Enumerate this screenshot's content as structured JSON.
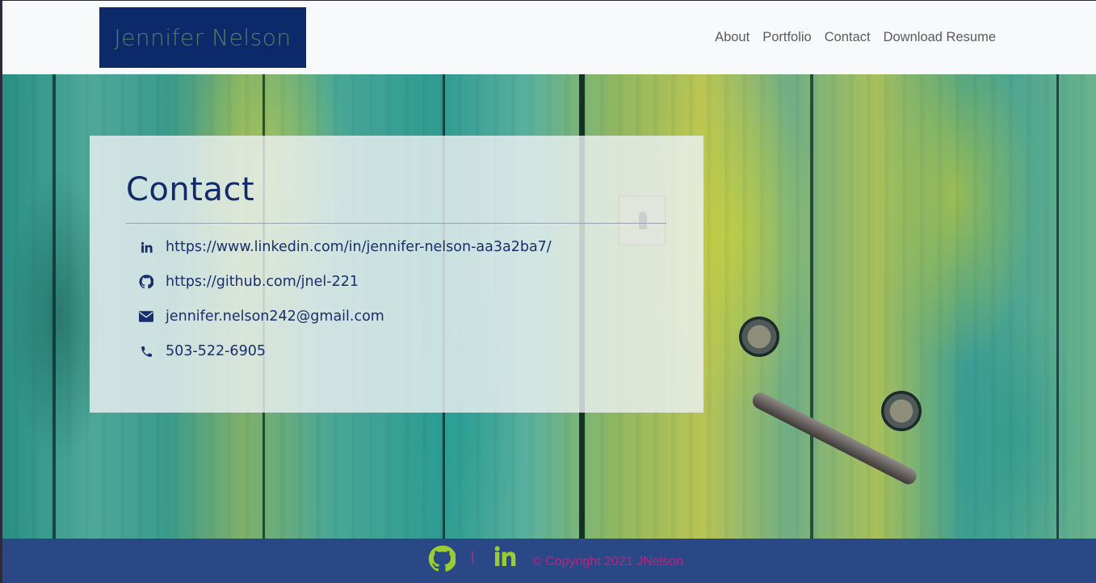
{
  "brand": {
    "name": "Jennifer Nelson",
    "bg_color": "#0c2a6a"
  },
  "nav": {
    "items": [
      {
        "label": "About"
      },
      {
        "label": "Portfolio"
      },
      {
        "label": "Contact"
      },
      {
        "label": "Download Resume"
      }
    ]
  },
  "contact": {
    "title": "Contact",
    "rows": [
      {
        "icon": "linkedin-icon",
        "text": "https://www.linkedin.com/in/jennifer-nelson-aa3a2ba7/"
      },
      {
        "icon": "github-icon",
        "text": "https://github.com/jnel-221"
      },
      {
        "icon": "envelope-icon",
        "text": "jennifer.nelson242@gmail.com"
      },
      {
        "icon": "phone-icon",
        "text": "503-522-6905"
      }
    ]
  },
  "footer": {
    "separator": "|",
    "copyright": "© Copyright 2021 JNelson",
    "icon_color": "#9acd32",
    "text_color": "#c0227f"
  }
}
